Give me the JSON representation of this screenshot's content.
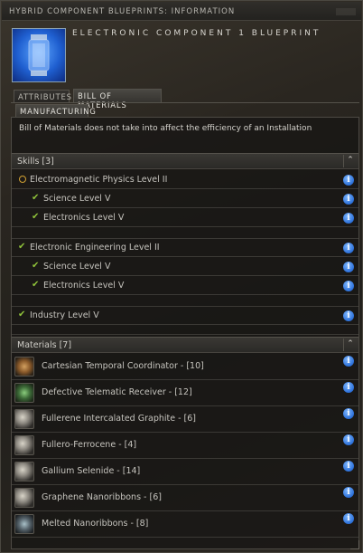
{
  "window": {
    "title": "HYBRID COMPONENT BLUEPRINTS: INFORMATION"
  },
  "header": {
    "item_title": "ELECTRONIC COMPONENT 1 BLUEPRINT",
    "icon": "blueprint-canister-icon"
  },
  "tabs": [
    {
      "label": "ATTRIBUTES",
      "active": false
    },
    {
      "label": "BILL OF MATERIALS",
      "active": true
    }
  ],
  "subtabs": [
    {
      "label": "MANUFACTURING",
      "active": true
    }
  ],
  "notice": "Bill of Materials does not take into affect the efficiency of an Installation",
  "skills": {
    "heading": "Skills [3]",
    "groups": [
      {
        "name": "Electromagnetic Physics Level II",
        "status": "partial",
        "prereqs": [
          "Science Level V",
          "Electronics Level V"
        ]
      },
      {
        "name": "Electronic Engineering Level II",
        "status": "met",
        "prereqs": [
          "Science Level V",
          "Electronics Level V"
        ]
      },
      {
        "name": "Industry Level V",
        "status": "met",
        "prereqs": []
      }
    ]
  },
  "materials": {
    "heading": "Materials [7]",
    "items": [
      {
        "label": "Cartesian Temporal Coordinator - [10]",
        "icon": "gear"
      },
      {
        "label": "Defective Telematic Receiver - [12]",
        "icon": "chip"
      },
      {
        "label": "Fullerene Intercalated Graphite - [6]",
        "icon": "shiny"
      },
      {
        "label": "Fullero-Ferrocene - [4]",
        "icon": "shiny"
      },
      {
        "label": "Gallium Selenide - [14]",
        "icon": "shiny"
      },
      {
        "label": "Graphene Nanoribbons - [6]",
        "icon": "shiny"
      },
      {
        "label": "Melted Nanoribbons - [8]",
        "icon": "ribbon"
      }
    ]
  },
  "colors": {
    "check": "#8fc23a",
    "partial": "#d2a233",
    "info": "#2b6fd8"
  }
}
